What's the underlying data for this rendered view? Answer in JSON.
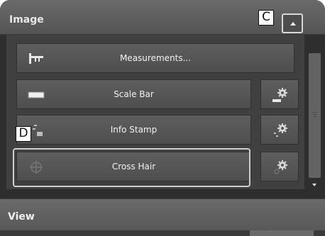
{
  "image_panel": {
    "title": "Image",
    "buttons": {
      "measurements": "Measurements...",
      "scale_bar": "Scale Bar",
      "info_stamp": "Info Stamp",
      "cross_hair": "Cross Hair"
    }
  },
  "callouts": {
    "collapse": "C",
    "cross_hair": "D"
  },
  "view_panel": {
    "title": "View"
  },
  "icons": {
    "measurements": "caliper-icon",
    "scale_bar": "scale-bar-icon",
    "info_stamp": "info-stamp-icon",
    "cross_hair": "crosshair-icon",
    "settings": "gear-icon",
    "collapse": "triangle-up-icon"
  },
  "colors": {
    "header_bg": "#5f5f5f",
    "panel_bg": "#404040",
    "button_bg": "#575757",
    "text": "#f2f2f2",
    "highlight_border": "#cfcfcf"
  }
}
